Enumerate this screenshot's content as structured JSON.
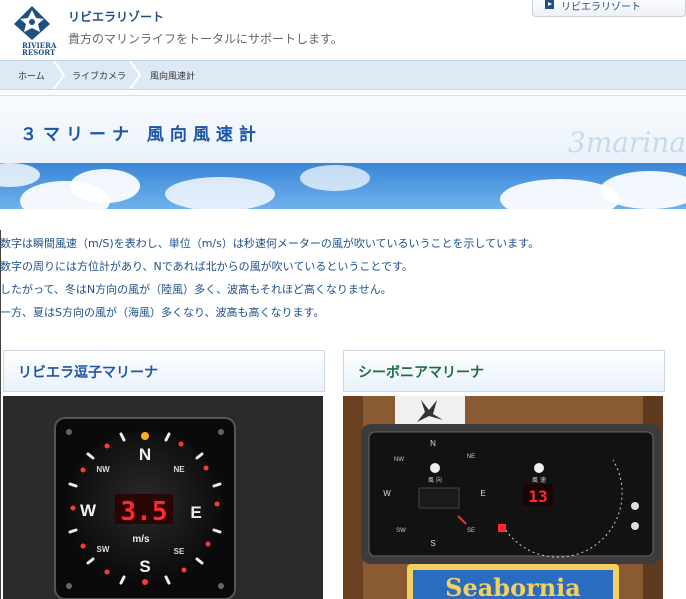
{
  "header": {
    "site_name": "リビエラリゾート",
    "tagline": "貴方のマリンライフをトータルにサポートします。",
    "logo_text_1": "RIVIERA",
    "logo_text_2": "RESORT",
    "top_link": "リビエラリゾート"
  },
  "breadcrumb": [
    "ホーム",
    "ライブカメラ",
    "風向風速計"
  ],
  "page": {
    "title": "３マリーナ 風向風速計",
    "watermark": "3marina"
  },
  "description": [
    "数字は瞬間風速（m/S)を表わし、単位（m/s）は秒速何メーターの風が吹いているいうことを示しています。",
    "数字の周りには方位計があり、Nであれば北からの風が吹いているということです。",
    "したがって、冬はN方向の風が（陸風）多く、波高もそれほど高くなりません。",
    "一方、夏はS方向の風が（海風）多くなり、波高も高くなります。"
  ],
  "panels": [
    {
      "title": "リビエラ逗子マリーナ",
      "color": "#1f56a8",
      "gauge": {
        "reading": "3.5",
        "unit": "m/s",
        "N": "N",
        "S": "S",
        "E": "E",
        "W": "W",
        "NE": "NE",
        "NW": "NW",
        "SE": "SE",
        "SW": "SW"
      }
    },
    {
      "title": "シーボニアマリーナ",
      "color": "#1c6b4a",
      "gauge": {
        "reading": "13",
        "N": "N",
        "S": "S",
        "E": "E",
        "W": "W",
        "NE": "NE",
        "NW": "NW",
        "SE": "SE",
        "SW": "SW",
        "label_dir": "風 向",
        "label_speed": "風 速",
        "sign": "Seabornia"
      }
    }
  ],
  "colors": {
    "accent": "#1a56a8",
    "breadcrumb_bg": "#dde9f4",
    "text_blue": "#1d4f8c",
    "led_red": "#ff2a2a"
  }
}
